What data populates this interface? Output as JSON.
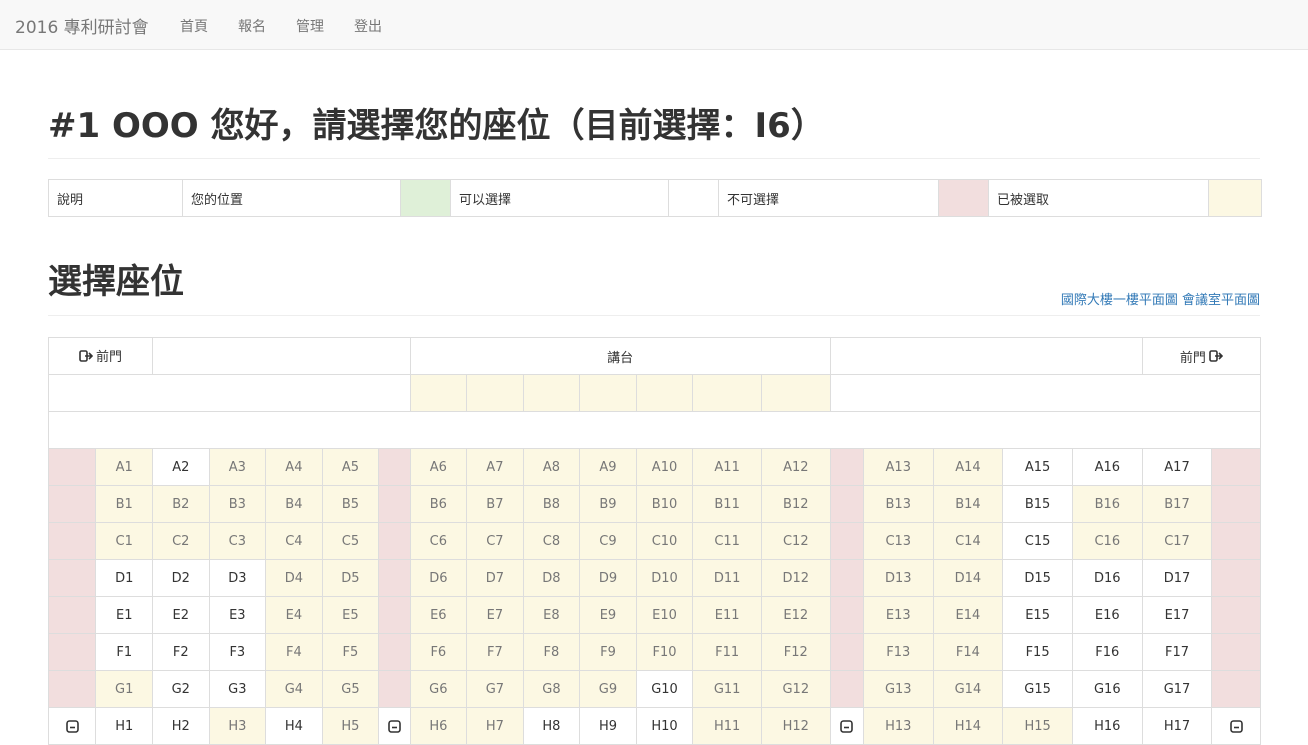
{
  "nav": {
    "brand": "2016 專利研討會",
    "links": [
      "首頁",
      "報名",
      "管理",
      "登出"
    ]
  },
  "page_title": "#1 OOO 您好，請選擇您的座位（目前選擇：I6）",
  "legend": {
    "items": [
      {
        "label": "說明",
        "swatch": null
      },
      {
        "label": "您的位置",
        "swatch": "#dff0d8"
      },
      {
        "label": "可以選擇",
        "swatch": "#ffffff"
      },
      {
        "label": "不可選擇",
        "swatch": "#f2dede"
      },
      {
        "label": "已被選取",
        "swatch": "#fcf8e3"
      }
    ]
  },
  "section_title": "選擇座位",
  "floor_links": [
    "國際大樓一樓平面圖",
    "會議室平面圖"
  ],
  "seating": {
    "front_door_left": "前門",
    "front_door_right": "前門",
    "podium": "講台",
    "rows": [
      {
        "label": "A",
        "status": "AWAAAAAAAAAAAAWWW"
      },
      {
        "label": "B",
        "status": "AAAAAAAAAAAAAAWAA"
      },
      {
        "label": "C",
        "status": "AAAAAAAAAAAAAAWAA"
      },
      {
        "label": "D",
        "status": "WWWAAAAAAAAAAAWWW"
      },
      {
        "label": "E",
        "status": "WWWAAAAAAAAAAAWWW"
      },
      {
        "label": "F",
        "status": "WWWAAAAAAAAAAAWWW"
      },
      {
        "label": "G",
        "status": "AWWAAAAAAWAAAAWWW"
      },
      {
        "label": "H",
        "status": "WWAWAAAWWWAAAAAWW"
      }
    ]
  },
  "colors": {
    "available": "#fcf8e3",
    "occupied": "#f2dede",
    "mine": "#dff0d8",
    "link": "#337ab7"
  }
}
